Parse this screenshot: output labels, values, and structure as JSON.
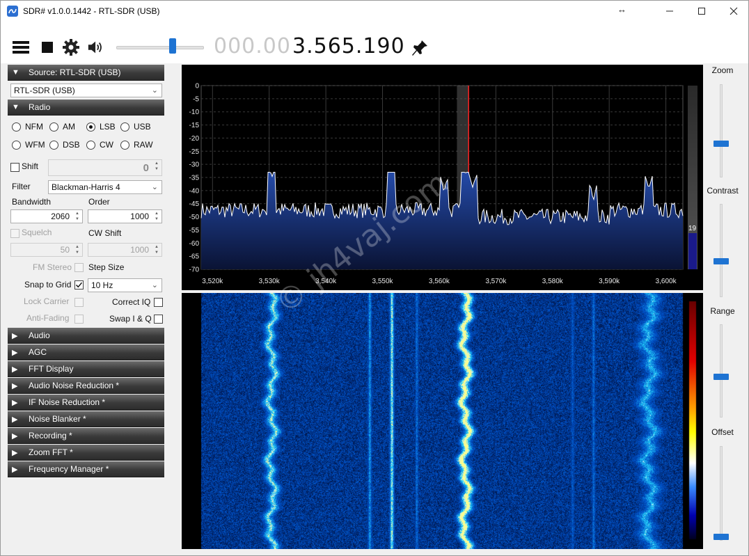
{
  "window": {
    "title": "SDR# v1.0.0.1442 - RTL-SDR (USB)",
    "resize_glyph": "↔",
    "minimize_glyph": "─",
    "maximize_glyph": "☐",
    "close_glyph": "✕"
  },
  "toolbar": {
    "frequency_dim": "000.00",
    "frequency_main": "3.565.190",
    "volume_level": 0.62,
    "icons": [
      "menu-icon",
      "stop-icon",
      "gear-icon",
      "speaker-icon",
      "pin-icon"
    ]
  },
  "source": {
    "header": "Source: RTL-SDR (USB)",
    "device": "RTL-SDR (USB)"
  },
  "radio": {
    "header": "Radio",
    "modes": [
      {
        "label": "NFM",
        "selected": false
      },
      {
        "label": "AM",
        "selected": false
      },
      {
        "label": "LSB",
        "selected": true
      },
      {
        "label": "USB",
        "selected": false
      },
      {
        "label": "WFM",
        "selected": false
      },
      {
        "label": "DSB",
        "selected": false
      },
      {
        "label": "CW",
        "selected": false
      },
      {
        "label": "RAW",
        "selected": false
      }
    ],
    "shift_label": "Shift",
    "shift_value": "0",
    "filter_label": "Filter",
    "filter_value": "Blackman-Harris 4",
    "bandwidth_label": "Bandwidth",
    "bandwidth_value": "2060",
    "order_label": "Order",
    "order_value": "1000",
    "squelch_label": "Squelch",
    "squelch_value": "50",
    "cw_shift_label": "CW Shift",
    "cw_shift_value": "1000",
    "fm_stereo_label": "FM Stereo",
    "step_size_label": "Step Size",
    "snap_to_grid_label": "Snap to Grid",
    "snap_to_grid_checked": true,
    "step_size_value": "10 Hz",
    "lock_carrier_label": "Lock Carrier",
    "correct_iq_label": "Correct IQ",
    "anti_fading_label": "Anti-Fading",
    "swap_iq_label": "Swap I & Q"
  },
  "panels": [
    "Audio",
    "AGC",
    "FFT Display",
    "Audio Noise Reduction *",
    "IF Noise Reduction *",
    "Noise Blanker *",
    "Recording *",
    "Zoom FFT *",
    "Frequency Manager *"
  ],
  "collapsed_glyph": "▶",
  "expanded_glyph": "▼",
  "right_sliders": {
    "zoom_label": "Zoom",
    "contrast_label": "Contrast",
    "range_label": "Range",
    "offset_label": "Offset"
  },
  "spectrum": {
    "y_ticks": [
      "0",
      "-5",
      "-10",
      "-15",
      "-20",
      "-25",
      "-30",
      "-35",
      "-40",
      "-45",
      "-50",
      "-55",
      "-60",
      "-65",
      "-70"
    ],
    "x_ticks": [
      "3,520k",
      "3,530k",
      "3,540k",
      "3,550k",
      "3,560k",
      "3,570k",
      "3,580k",
      "3,590k",
      "3,600k"
    ],
    "ylim": [
      -70,
      0
    ],
    "xlim_khz": [
      3518,
      3603
    ],
    "tuned_khz": 3565.19,
    "filter_band_khz": [
      3563.13,
      3565.19
    ],
    "level_readout": "19",
    "colors": {
      "trace": "#ffffff",
      "fill_top": "#1f3f9a",
      "fill_bottom": "#0a1538",
      "cursor": "#ff2020",
      "band": "#5a5a5a"
    }
  },
  "watermark": "© jh4vaj.com"
}
